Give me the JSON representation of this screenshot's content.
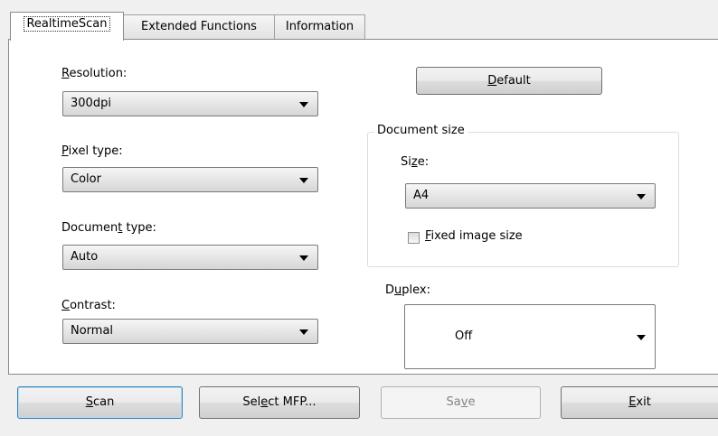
{
  "tabs": [
    {
      "label": "RealtimeScan",
      "active": true
    },
    {
      "label": "Extended Functions",
      "active": false
    },
    {
      "label": "Information",
      "active": false
    }
  ],
  "resolution": {
    "label_underlined": "R",
    "label_rest": "esolution:",
    "value": "300dpi"
  },
  "pixel_type": {
    "label_underlined": "P",
    "label_rest": "ixel type:",
    "value": "Color"
  },
  "document_type": {
    "label_pre": "Documen",
    "label_underlined": "t",
    "label_rest": " type:",
    "value": "Auto"
  },
  "contrast": {
    "label_underlined": "C",
    "label_rest": "ontrast:",
    "value": "Normal"
  },
  "default_button": {
    "underlined": "D",
    "rest": "efault"
  },
  "document_size": {
    "title": "Document size",
    "size_label_pre": "Si",
    "size_label_underlined": "z",
    "size_label_rest": "e:",
    "size_value": "A4",
    "fixed_underlined": "F",
    "fixed_rest": "ixed image size",
    "fixed_checked": false
  },
  "duplex": {
    "label_pre": "D",
    "label_underlined": "u",
    "label_rest": "plex:",
    "value": "Off"
  },
  "buttons": {
    "scan": {
      "underlined": "S",
      "rest": "can"
    },
    "select_mfp": {
      "pre": "Sel",
      "underlined": "e",
      "rest": "ct MFP..."
    },
    "save": {
      "pre": "Sa",
      "underlined": "v",
      "rest": "e"
    },
    "exit": {
      "underlined": "E",
      "rest": "xit"
    }
  },
  "colors": {
    "focus_border": "#3c7fb1",
    "disabled_text": "#838383"
  }
}
